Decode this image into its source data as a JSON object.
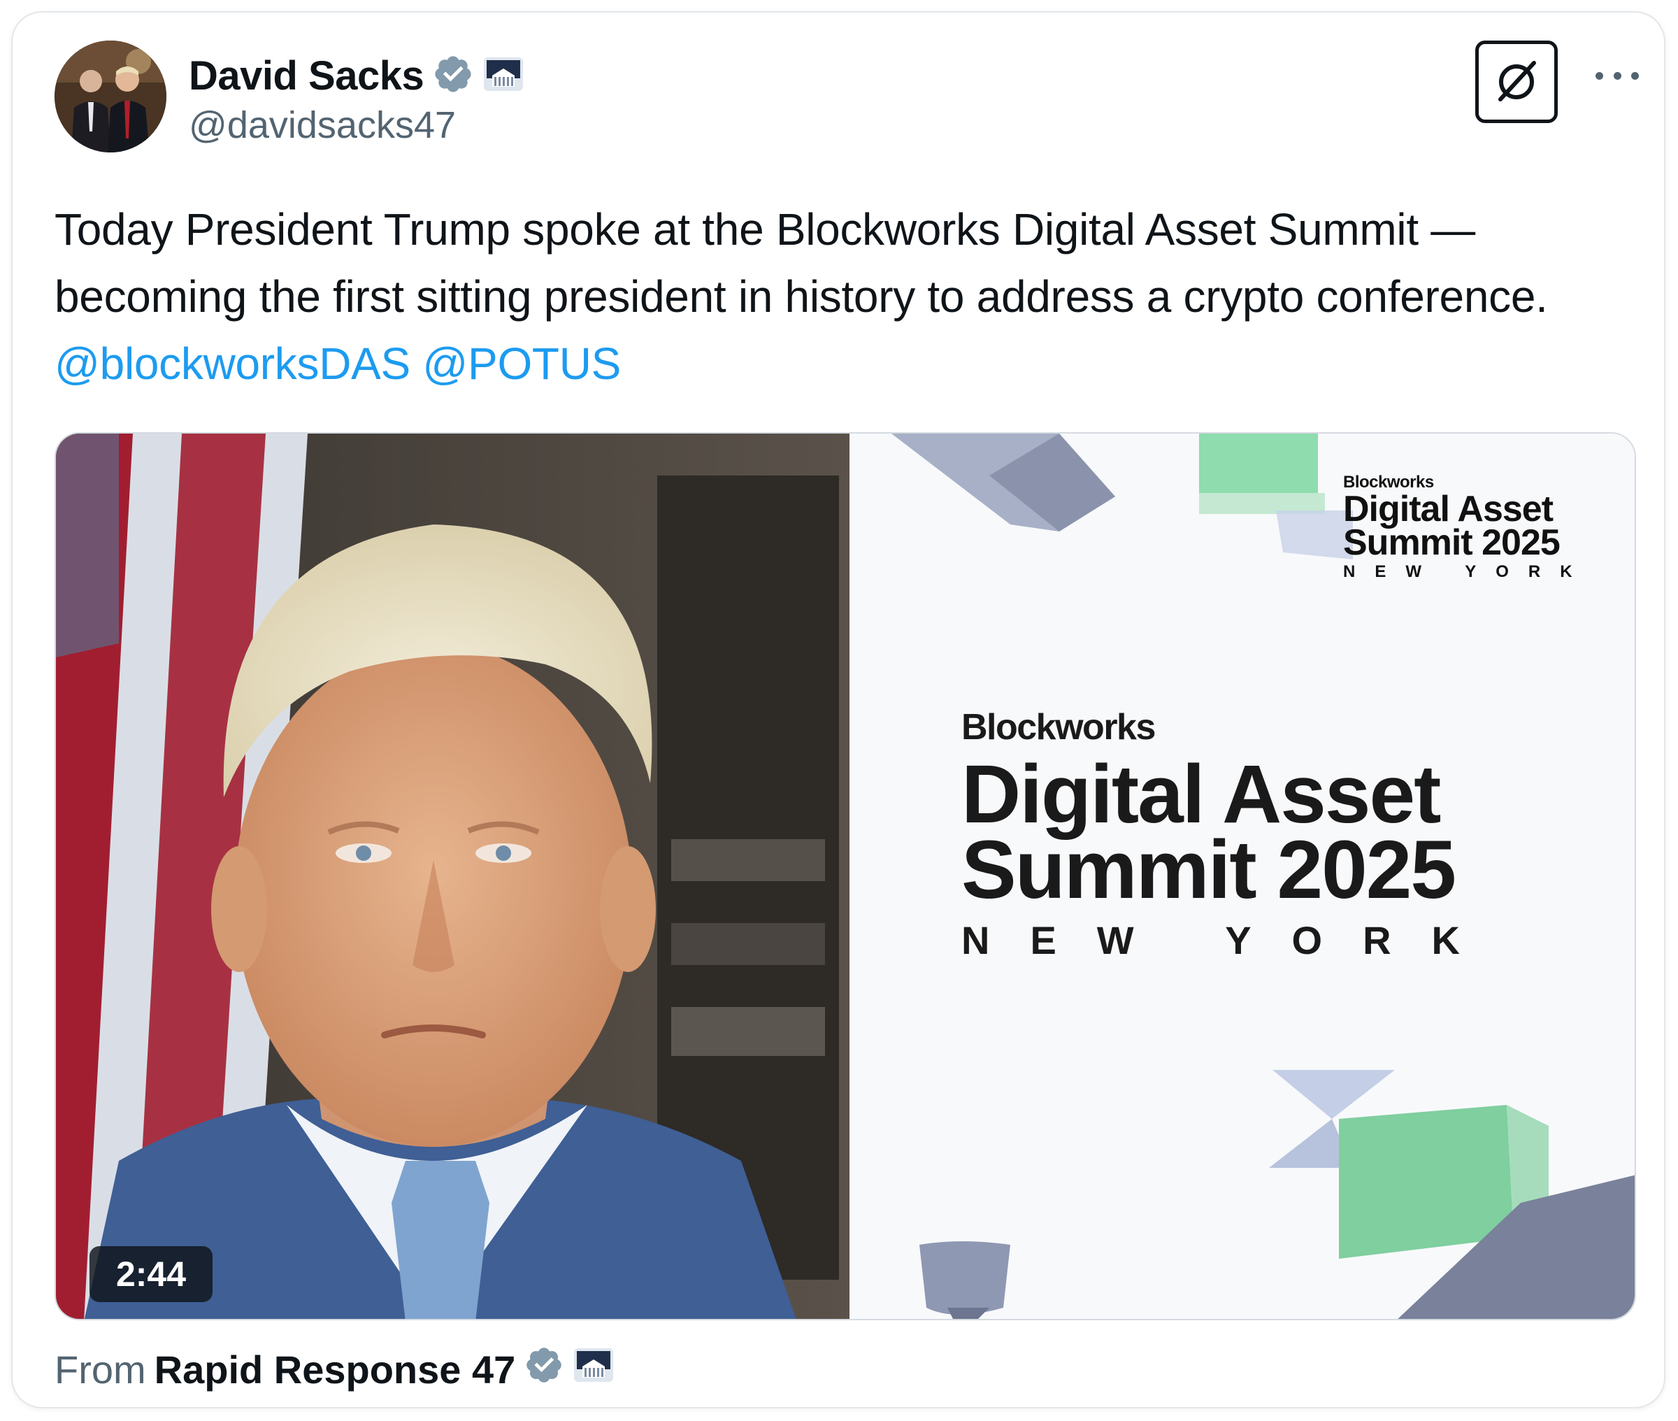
{
  "author": {
    "name": "David Sacks",
    "handle": "@davidsacks47",
    "verified_icon": "verified-badge-icon",
    "affiliation_icon": "white-house-icon"
  },
  "tweet": {
    "text": "Today President Trump spoke at the Blockworks Digital Asset Summit — becoming the first sitting president in history to address a crypto conference.",
    "mentions": [
      "@blockworksDAS",
      "@POTUS"
    ]
  },
  "media": {
    "duration": "2:44",
    "logo_small": {
      "brand": "Blockworks",
      "line1": "Digital Asset",
      "line2": "Summit",
      "year": "2025",
      "city": "NEW YORK"
    },
    "logo_big": {
      "brand": "Blockworks",
      "line1": "Digital Asset",
      "line2": "Summit",
      "year": "2025",
      "city": "NEW YORK"
    }
  },
  "source": {
    "from_label": "From",
    "name": "Rapid Response 47"
  },
  "icons": {
    "grok": "grok-icon",
    "more": "more-options-icon"
  },
  "colors": {
    "link": "#1d9bf0",
    "verified": "#829aab",
    "secondary_text": "#536471"
  }
}
